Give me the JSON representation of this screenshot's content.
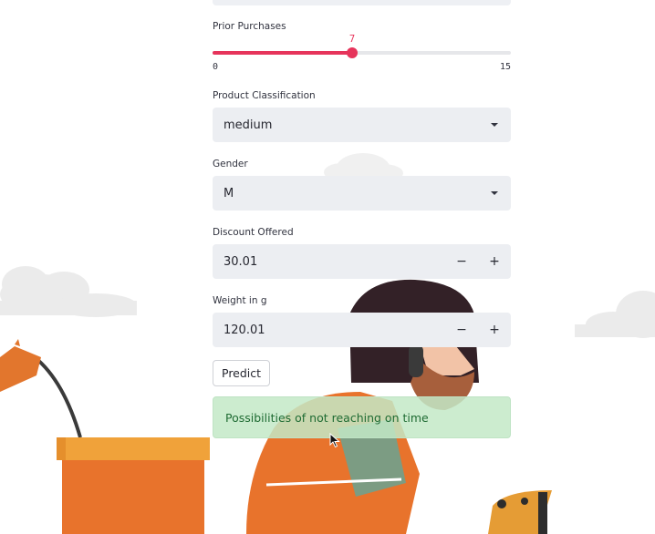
{
  "prior_purchases": {
    "label": "Prior Purchases",
    "value": "7",
    "min": "0",
    "max": "15",
    "fraction": 0.467,
    "accent": "#e6345b"
  },
  "product_classification": {
    "label": "Product Classification",
    "selected": "medium"
  },
  "gender": {
    "label": "Gender",
    "selected": "M"
  },
  "discount_offered": {
    "label": "Discount Offered",
    "value": "30.01",
    "decrement": "−",
    "increment": "+"
  },
  "weight": {
    "label": "Weight in g",
    "value": "120.01",
    "decrement": "−",
    "increment": "+"
  },
  "predict_button": {
    "label": "Predict"
  },
  "result": {
    "text": "Possibilities of not reaching on time",
    "color": "#1f6b33"
  },
  "icons": {
    "select_caret": "chevron-down-icon",
    "cursor": "mouse-pointer-icon"
  }
}
